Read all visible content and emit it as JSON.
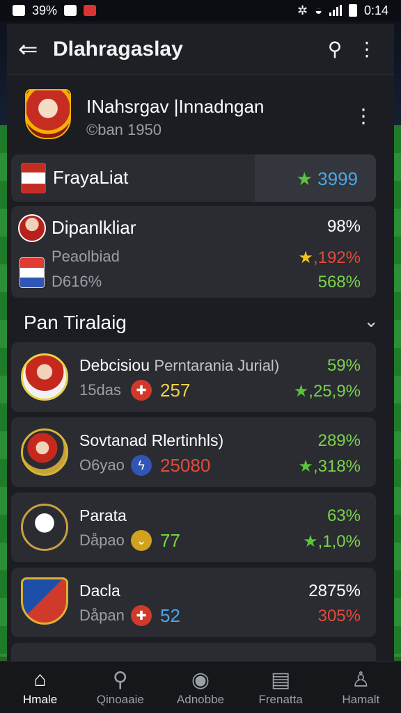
{
  "status": {
    "left_text": "39%",
    "time": "0:14"
  },
  "header": {
    "title": "Dlahragaslay"
  },
  "profile": {
    "name": "INahsrgav |Innadngan",
    "subtitle": "©ban 1950"
  },
  "featured": {
    "name": "FrayaLiat",
    "value": "3999"
  },
  "stats": {
    "name": "Dipanlkliar",
    "value": "98%",
    "row2_label": "Peaolbiad",
    "row2_value": ",192%",
    "row3_label": "D616%",
    "row3_value": "568%"
  },
  "section": {
    "title": "Pan Tiralaig"
  },
  "teams": [
    {
      "name": "Debcisiou",
      "extra": "Perntarania Jurial)",
      "pct": "59%",
      "sub": "15das",
      "num": "257",
      "num_color": "#f0d34a",
      "change": ",25,9%",
      "change_color": "#7bd24a",
      "pct_color": "#7bd24a"
    },
    {
      "name": "Sovtanad Rlertinhls)",
      "extra": "",
      "pct": "289%",
      "sub": "O6yao",
      "num": "25080",
      "num_color": "#e04b3c",
      "change": ",318%",
      "change_color": "#7bd24a",
      "pct_color": "#7bd24a"
    },
    {
      "name": "Parata",
      "extra": "",
      "pct": "63%",
      "sub": "Dåpao",
      "num": "77",
      "num_color": "#7bd24a",
      "change": ",1,0%",
      "change_color": "#7bd24a",
      "pct_color": "#7bd24a"
    },
    {
      "name": "Dacla",
      "extra": "",
      "pct": "2875%",
      "sub": "Dåpan",
      "num": "52",
      "num_color": "#4aa7e6",
      "change": "305%",
      "change_color": "#e04b3c",
      "pct_color": "#ffffff"
    }
  ],
  "nav": [
    {
      "label": "Hmale",
      "icon": "home-icon"
    },
    {
      "label": "Qinoaaie",
      "icon": "search-icon"
    },
    {
      "label": "Adnobbe",
      "icon": "ball-icon"
    },
    {
      "label": "Frenatta",
      "icon": "news-icon"
    },
    {
      "label": "Hamalt",
      "icon": "profile-icon"
    }
  ]
}
